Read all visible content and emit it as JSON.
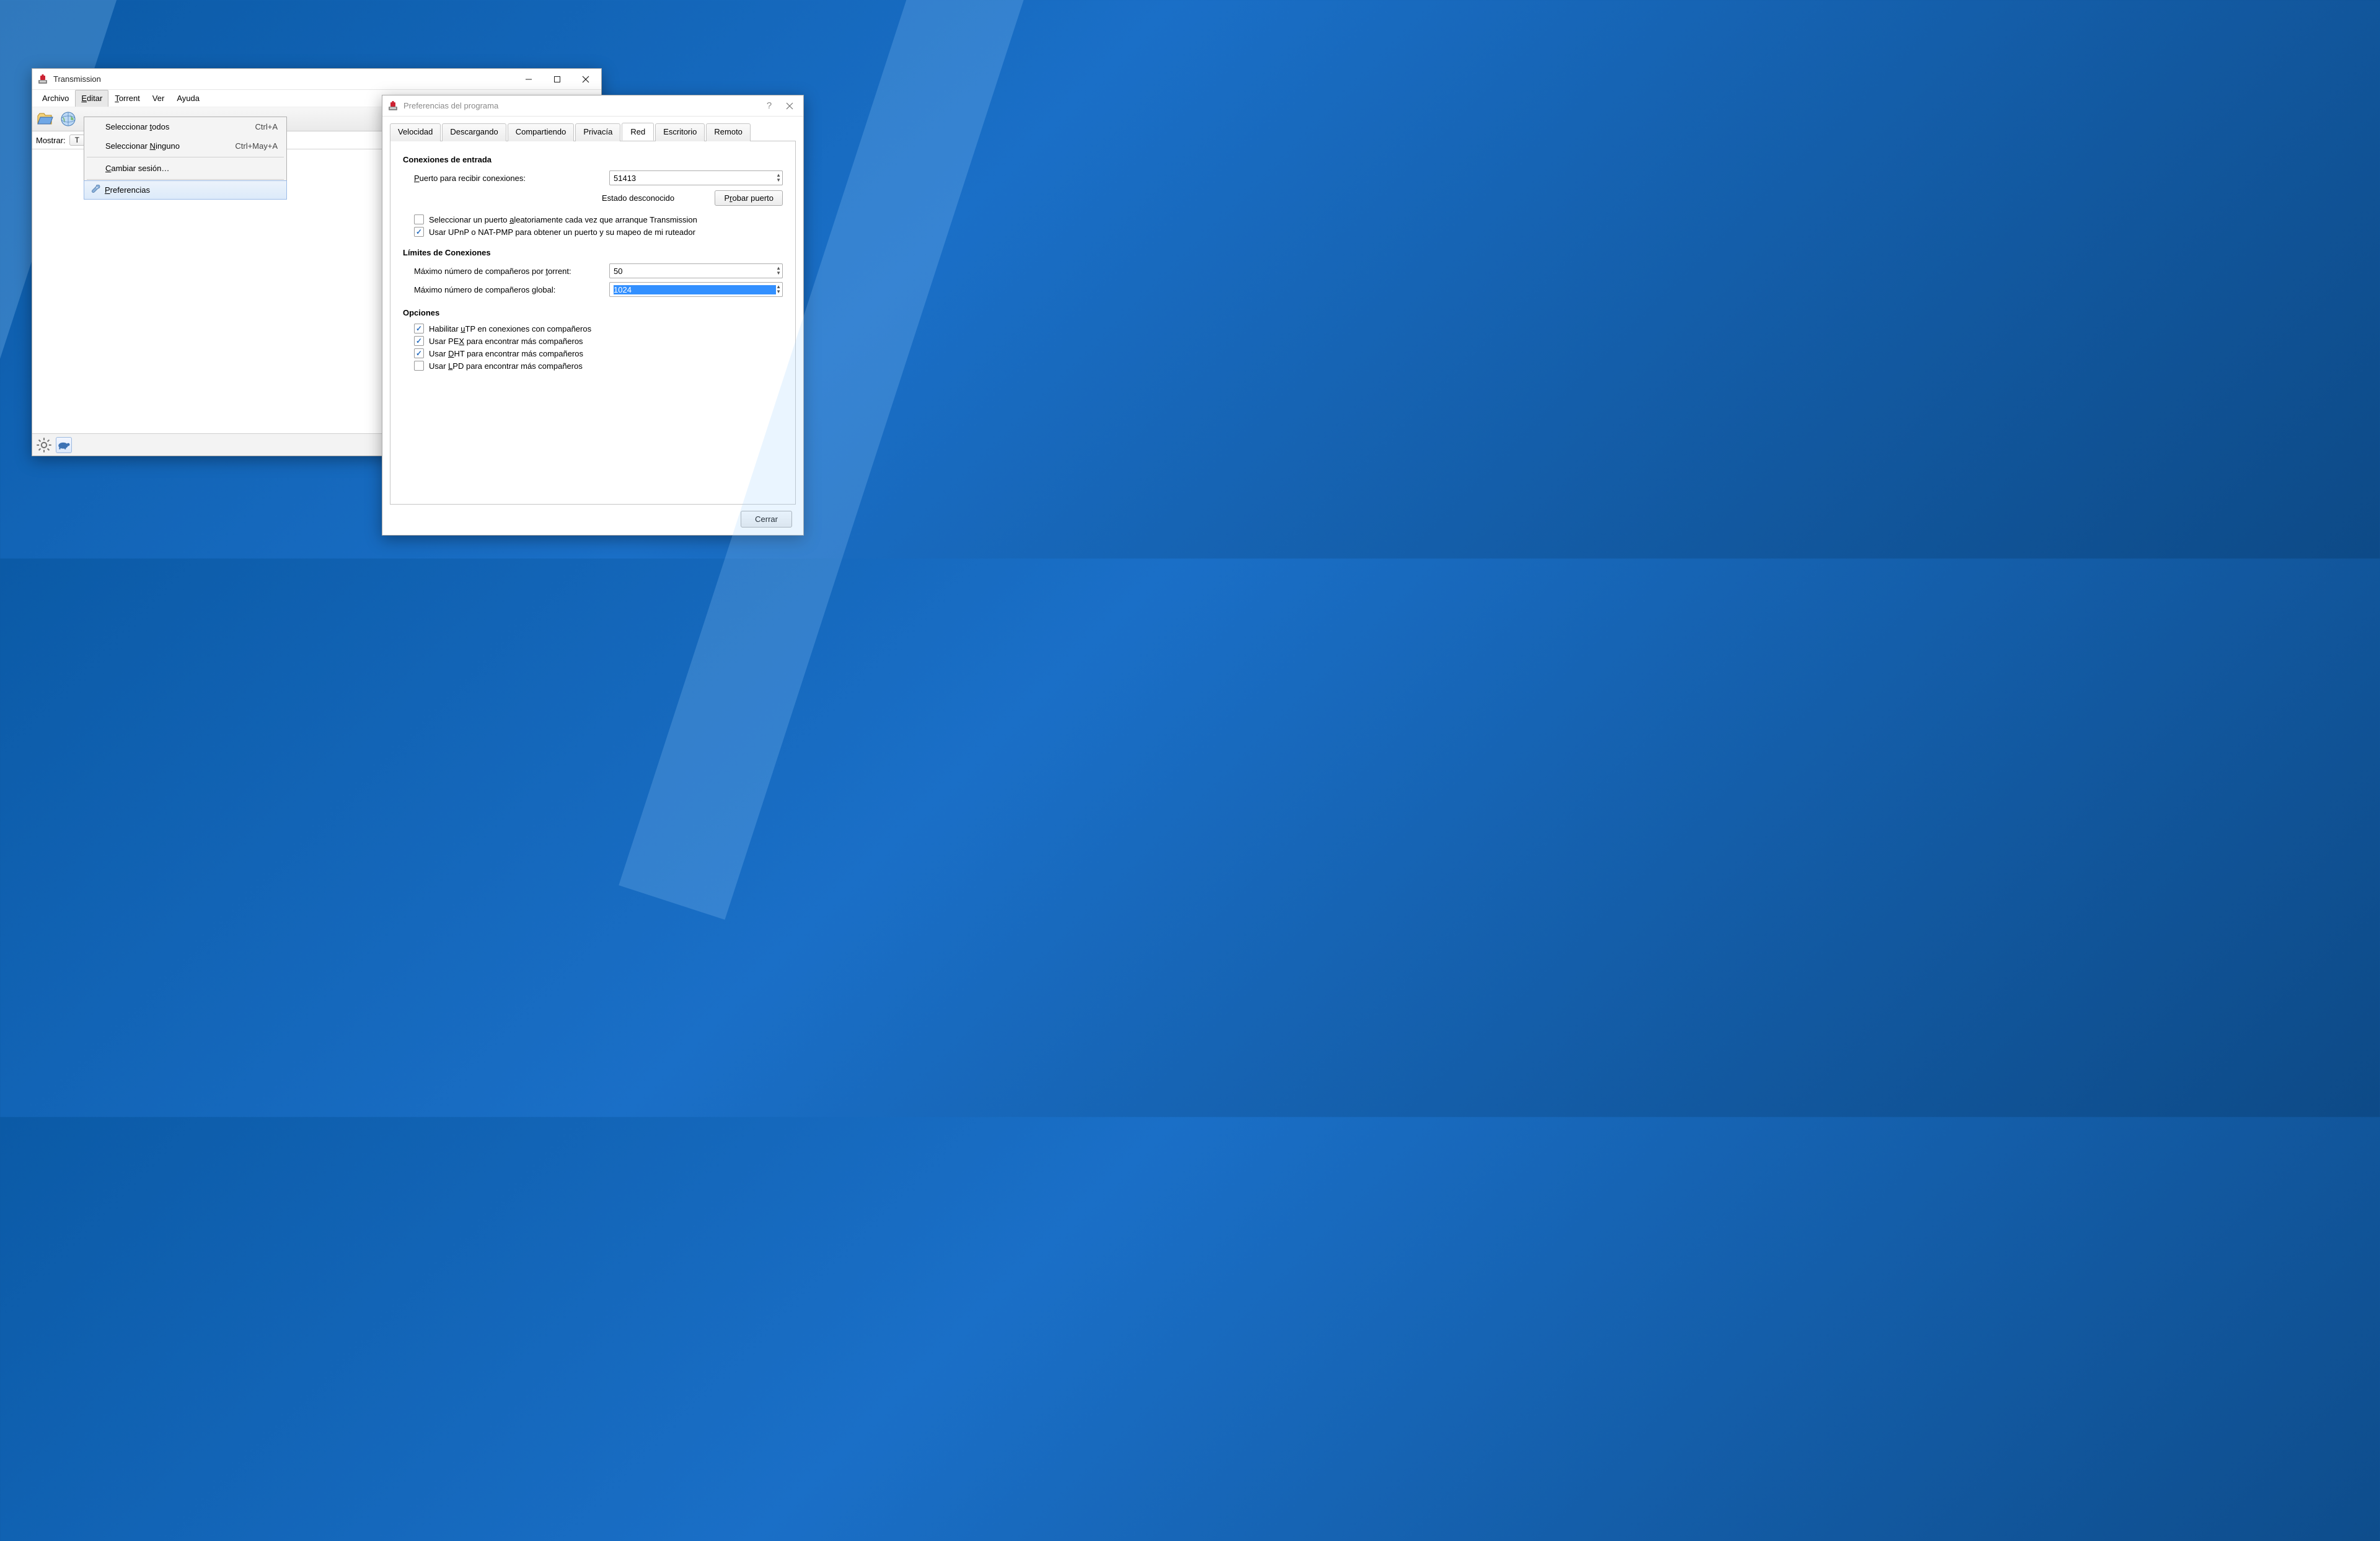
{
  "mainWindow": {
    "title": "Transmission",
    "menu": {
      "archivo": "Archivo",
      "editar": "Editar",
      "torrent": "Torrent",
      "ver": "Ver",
      "ayuda": "Ayuda"
    },
    "filter": {
      "label": "Mostrar:",
      "button": "T"
    },
    "dropdown": {
      "selectAll": "Seleccionar todos",
      "selectAllShortcut": "Ctrl+A",
      "selectNone": "Seleccionar Ninguno",
      "selectNoneShortcut": "Ctrl+May+A",
      "changeSession": "Cambiar sesión…",
      "preferences": "Preferencias"
    }
  },
  "prefs": {
    "title": "Preferencias del programa",
    "tabs": {
      "velocidad": "Velocidad",
      "descargando": "Descargando",
      "compartiendo": "Compartiendo",
      "privacia": "Privacía",
      "red": "Red",
      "escritorio": "Escritorio",
      "remoto": "Remoto"
    },
    "incoming": {
      "heading": "Conexiones de entrada",
      "portLabel": "Puerto para recibir conexiones:",
      "portValue": "51413",
      "statusText": "Estado desconocido",
      "testButton": "Probar puerto",
      "randomPort": "Seleccionar un puerto aleatoriamente cada vez que arranque Transmission",
      "upnp": "Usar UPnP o NAT-PMP para obtener un puerto y su mapeo de mi ruteador"
    },
    "limits": {
      "heading": "Límites de Conexiones",
      "perTorrentLabel": "Máximo número de compañeros por torrent:",
      "perTorrentValue": "50",
      "globalLabel": "Máximo número de compañeros global:",
      "globalValue": "1024"
    },
    "options": {
      "heading": "Opciones",
      "utp": "Habilitar uTP en conexiones con compañeros",
      "pex": "Usar PEX para encontrar más compañeros",
      "dht": "Usar DHT para encontrar más compañeros",
      "lpd": "Usar LPD para encontrar más compañeros"
    },
    "closeButton": "Cerrar"
  }
}
